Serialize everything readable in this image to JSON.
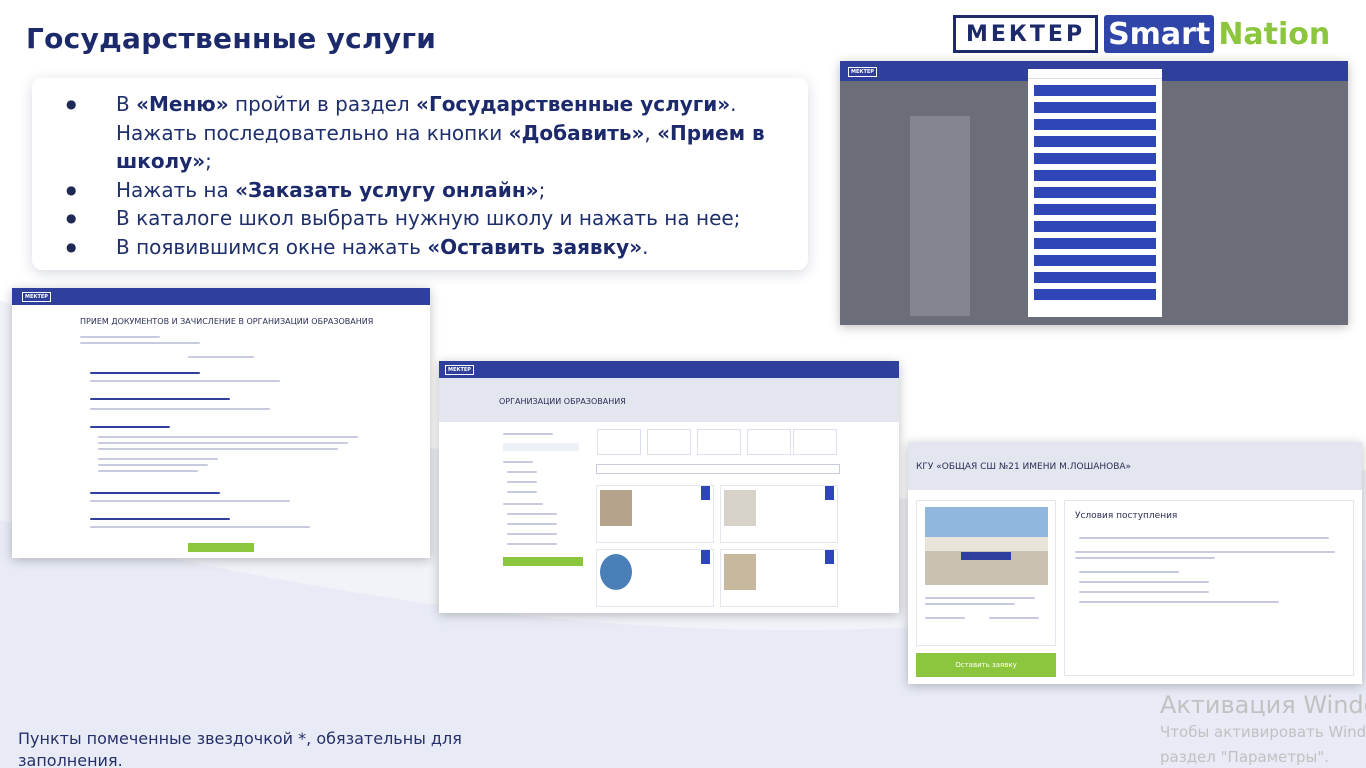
{
  "slide": {
    "title": "Государственные услуги",
    "footnote": "Пункты помеченные звездочкой *, обязательны для заполнения."
  },
  "logos": {
    "mekter": "МЕКТЕР",
    "smart": "Smart",
    "nation": "Nation",
    "brand_colors": {
      "navy": "#1c2a6b",
      "blue": "#2f46a8",
      "green": "#8cc63f"
    }
  },
  "steps": [
    {
      "parts": [
        {
          "t": "В ",
          "b": false
        },
        {
          "t": "«Меню»",
          "b": true
        },
        {
          "t": " пройти в раздел ",
          "b": false
        },
        {
          "t": "«Государственные услуги»",
          "b": true
        },
        {
          "t": ". Нажать последовательно на кнопки ",
          "b": false
        },
        {
          "t": "«Добавить»",
          "b": true
        },
        {
          "t": ", ",
          "b": false
        },
        {
          "t": "«Прием в школу»",
          "b": true
        },
        {
          "t": ";",
          "b": false
        }
      ]
    },
    {
      "parts": [
        {
          "t": "Нажать на ",
          "b": false
        },
        {
          "t": "«Заказать услугу онлайн»",
          "b": true
        },
        {
          "t": ";",
          "b": false
        }
      ]
    },
    {
      "parts": [
        {
          "t": "В каталоге школ выбрать нужную школу и нажать на нее;",
          "b": false
        }
      ]
    },
    {
      "parts": [
        {
          "t": "В появившимся окне нажать ",
          "b": false
        },
        {
          "t": "«Оставить заявку»",
          "b": true
        },
        {
          "t": ".",
          "b": false
        }
      ]
    }
  ],
  "screenshots": {
    "menu_dialog": {
      "button_count": 13
    },
    "admission_doc": {
      "title": "ПРИЕМ ДОКУМЕНТОВ И ЗАЧИСЛЕНИЕ В ОРГАНИЗАЦИИ ОБРАЗОВАНИЯ"
    },
    "org_list": {
      "title": "ОРГАНИЗАЦИИ ОБРАЗОВАНИЯ"
    },
    "school": {
      "title": "КГУ «ОБЩАЯ СШ №21 ИМЕНИ М.ЛОШАНОВА»",
      "conditions_title": "Условия поступления",
      "apply_button": "Оставить заявку"
    }
  },
  "watermark": {
    "line1": "Активация Windows",
    "line2": "Чтобы активировать Windows, перейдите в",
    "line3": "раздел \"Параметры\"."
  }
}
